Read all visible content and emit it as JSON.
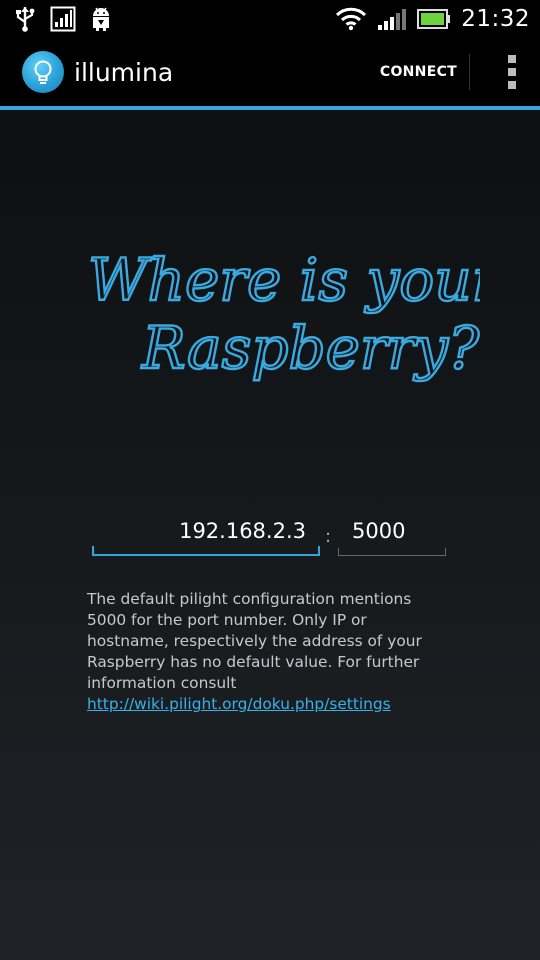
{
  "status_bar": {
    "time": "21:32",
    "left_icons": [
      "usb-icon",
      "signal-strength-icon",
      "android-debug-icon"
    ],
    "right_icons": [
      "wifi-icon",
      "cell-signal-icon",
      "battery-icon"
    ]
  },
  "action_bar": {
    "title": "illumina",
    "app_icon": "lightbulb-icon",
    "connect_label": "CONNECT",
    "overflow_icon": "overflow-menu-icon",
    "accent_color": "#34a6dc"
  },
  "heading": {
    "line1": "Where is your",
    "line2": "Raspberry?"
  },
  "form": {
    "host_value": "192.168.2.3",
    "separator": ":",
    "port_value": "5000"
  },
  "help": {
    "text": "The default pilight configuration mentions 5000 for the port number. Only IP or hostname, respectively the address of your Raspberry has no default value. For further information consult ",
    "link_text": "http://wiki.pilight.org/doku.php/settings"
  }
}
